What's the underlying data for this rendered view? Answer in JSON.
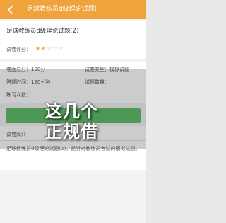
{
  "header": {
    "title": "足球教练员d级理论试题(",
    "back_icon": "chevron-left-icon"
  },
  "exam": {
    "title": "足球教练员d级理论试题(2)",
    "rating_label": "试卷评分：",
    "rating": {
      "filled": 2,
      "total": 5
    }
  },
  "info": {
    "total_score": "卷面总分：100分",
    "paper_type": "试卷类型：模拟试题",
    "time_limit": "答题时间：120分钟",
    "question_count": "试题数量：",
    "attempts": "练习次数："
  },
  "start_button": {
    "color": "#5fbe6a"
  },
  "intro": {
    "label": "试卷简介",
    "text": "足球教练员d级理论试题(2)，是针对教练员考试的模拟试题。"
  },
  "watermark": {
    "line1": "这几个",
    "line2": "正规借"
  },
  "colors": {
    "accent": "#f0a23c",
    "button": "#5fbe6a",
    "star_empty": "#b5b5b5"
  }
}
